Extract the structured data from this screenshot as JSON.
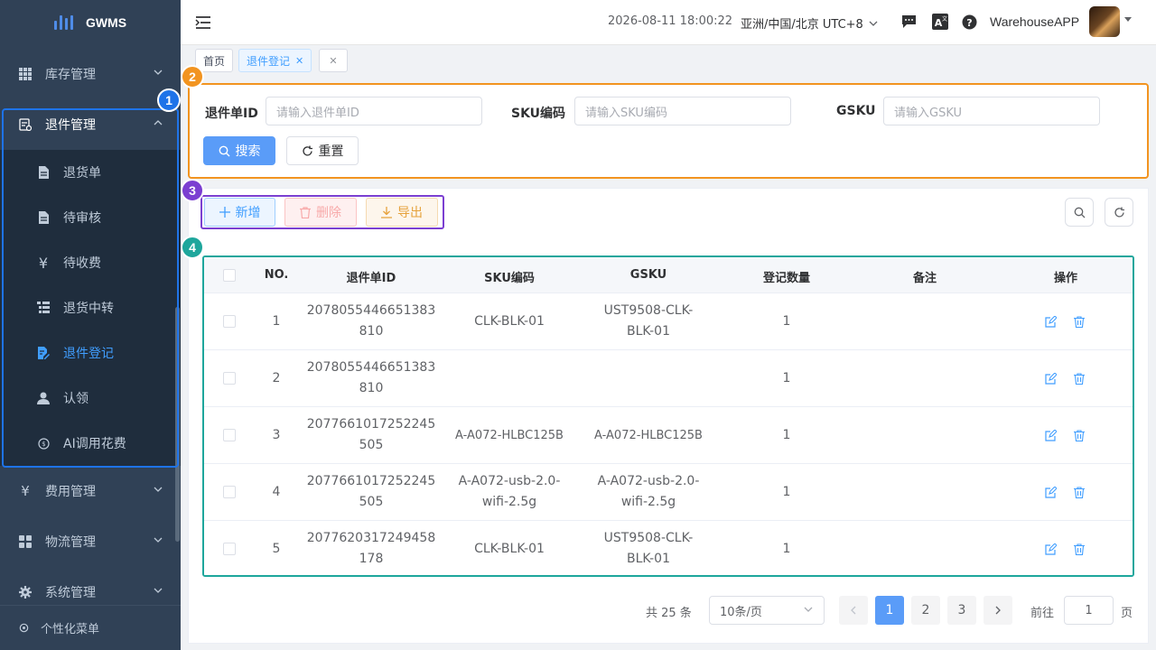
{
  "app": {
    "logo_text": "GWMS",
    "brand_color": "#409eff"
  },
  "sidebar": {
    "menus": [
      {
        "label": "库存管理",
        "icon": "grid-icon"
      },
      {
        "label": "退件管理",
        "icon": "return-doc-icon",
        "expanded": true
      },
      {
        "label": "费用管理",
        "icon": "yen-icon"
      },
      {
        "label": "物流管理",
        "icon": "apps-icon"
      },
      {
        "label": "系统管理",
        "icon": "gear-icon"
      }
    ],
    "submenu": [
      {
        "label": "退货单",
        "icon": "document-icon"
      },
      {
        "label": "待审核",
        "icon": "document-icon"
      },
      {
        "label": "待收费",
        "icon": "yen-icon"
      },
      {
        "label": "退货中转",
        "icon": "list-tree-icon"
      },
      {
        "label": "退件登记",
        "icon": "edit-doc-icon",
        "active": true
      },
      {
        "label": "认领",
        "icon": "user-icon"
      },
      {
        "label": "AI调用花费",
        "icon": "coin-icon"
      }
    ],
    "footer": "个性化菜单"
  },
  "header": {
    "datetime": "2026-08-11 18:00:22",
    "timezone": "亚洲/中国/北京 UTC+8",
    "user": "WarehouseAPP"
  },
  "tags": {
    "home": "首页",
    "current": "退件登记"
  },
  "search": {
    "fields": [
      {
        "label": "退件单ID",
        "placeholder": "请输入退件单ID"
      },
      {
        "label": "SKU编码",
        "placeholder": "请输入SKU编码"
      },
      {
        "label": "GSKU",
        "placeholder": "请输入GSKU"
      }
    ],
    "search_label": "搜索",
    "reset_label": "重置"
  },
  "toolbar": {
    "add_label": "新增",
    "delete_label": "删除",
    "export_label": "导出"
  },
  "table": {
    "columns": [
      "NO.",
      "退件单ID",
      "SKU编码",
      "GSKU",
      "登记数量",
      "备注",
      "操作"
    ],
    "rows": [
      {
        "no": "1",
        "id_a": "2078055446651383",
        "id_b": "810",
        "sku": "CLK-BLK-01",
        "gsku_a": "UST9508-CLK-",
        "gsku_b": "BLK-01",
        "qty": "1",
        "note": ""
      },
      {
        "no": "2",
        "id_a": "2078055446651383",
        "id_b": "810",
        "sku": "",
        "gsku_a": "",
        "gsku_b": "",
        "qty": "1",
        "note": ""
      },
      {
        "no": "3",
        "id_a": "2077661017252245",
        "id_b": "505",
        "sku": "A-A072-HLBC125B",
        "gsku_a": "A-A072-HLBC125B",
        "gsku_b": "",
        "qty": "1",
        "note": ""
      },
      {
        "no": "4",
        "id_a": "2077661017252245",
        "id_b": "505",
        "sku": "A-A072-usb-2.0-",
        "sku_b": "wifi-2.5g",
        "gsku_a": "A-A072-usb-2.0-",
        "gsku_b": "wifi-2.5g",
        "qty": "1",
        "note": ""
      },
      {
        "no": "5",
        "id_a": "2077620317249458",
        "id_b": "178",
        "sku": "CLK-BLK-01",
        "gsku_a": "UST9508-CLK-",
        "gsku_b": "BLK-01",
        "qty": "1",
        "note": ""
      }
    ]
  },
  "pagination": {
    "total": "共 25 条",
    "page_size": "10条/页",
    "pages": [
      "1",
      "2",
      "3"
    ],
    "current": "1",
    "goto_label": "前往",
    "goto_value": "1",
    "goto_unit": "页"
  },
  "callouts": [
    {
      "n": "1",
      "color": "#1e73e8"
    },
    {
      "n": "2",
      "color": "#f29420"
    },
    {
      "n": "3",
      "color": "#7b3fd1"
    },
    {
      "n": "4",
      "color": "#1ea69c"
    }
  ]
}
